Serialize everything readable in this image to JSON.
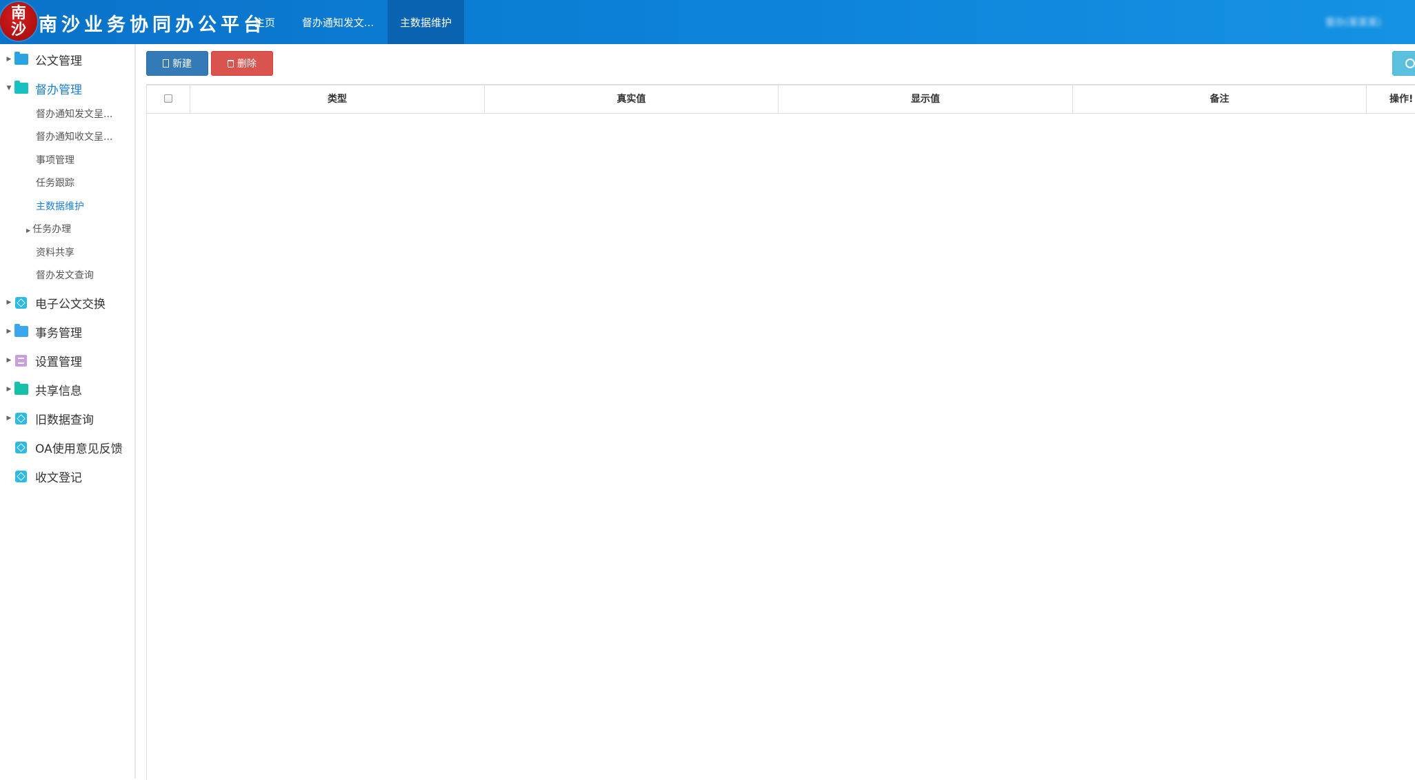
{
  "header": {
    "logo_text": [
      "南",
      "沙"
    ],
    "app_title": "南沙业务协同办公平台",
    "nav_tabs": [
      {
        "label": "主页"
      },
      {
        "label": "督办通知发文..."
      },
      {
        "label": "主数据维护",
        "active": true
      }
    ],
    "user_info": "督办(某某某)"
  },
  "sidebar": {
    "items": [
      {
        "label": "公文管理",
        "icon": "folder-icon",
        "icon_color": "#2ba3e3",
        "expanded": false
      },
      {
        "label": "督办管理",
        "icon": "folder-icon",
        "icon_color": "#17c1c0",
        "expanded": true,
        "children": [
          {
            "label": "督办通知发文呈..."
          },
          {
            "label": "督办通知收文呈..."
          },
          {
            "label": "事项管理"
          },
          {
            "label": "任务跟踪"
          },
          {
            "label": "主数据维护",
            "active": true
          },
          {
            "label": "任务办理",
            "has_children": true
          },
          {
            "label": "资料共享"
          },
          {
            "label": "督办发文查询"
          }
        ]
      },
      {
        "label": "电子公文交换",
        "icon": "cube-icon",
        "icon_color": "#2bb9e8",
        "expanded": false
      },
      {
        "label": "事务管理",
        "icon": "folder-icon",
        "icon_color": "#3aa6ee",
        "expanded": false
      },
      {
        "label": "设置管理",
        "icon": "list-icon",
        "icon_color": "#c89ee0",
        "expanded": false
      },
      {
        "label": "共享信息",
        "icon": "folder-icon",
        "icon_color": "#17c1a8",
        "expanded": false
      },
      {
        "label": "旧数据查询",
        "icon": "cube-icon",
        "icon_color": "#2bb9e8",
        "expanded": false
      },
      {
        "label": "OA使用意见反馈",
        "icon": "cube-icon",
        "icon_color": "#2bb9e8"
      },
      {
        "label": "收文登记",
        "icon": "cube-icon",
        "icon_color": "#2bb9e8"
      }
    ]
  },
  "toolbar": {
    "new_label": "新建",
    "delete_label": "删除",
    "new_color": "#337ab7",
    "delete_color": "#d9534f",
    "search_color": "#5bc0de"
  },
  "table": {
    "columns": [
      "类型",
      "真实值",
      "显示值",
      "备注",
      "操作!"
    ],
    "rows": []
  },
  "colors": {
    "topbar": "#0c82d8",
    "active_tab": "#0a63b0",
    "active_link": "#1a7ed5"
  }
}
